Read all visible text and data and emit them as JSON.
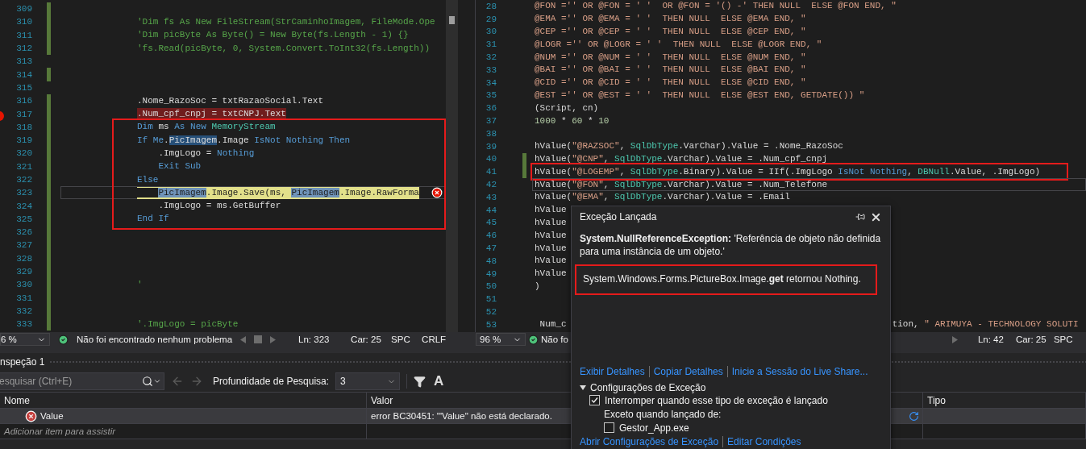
{
  "left_editor": {
    "blocks": [
      {
        "boxed": false,
        "lines": [
          {
            "number": "309",
            "changed": true,
            "breakpoint": false,
            "current": false,
            "caret": false
          },
          {
            "number": "310",
            "changed": true,
            "breakpoint": false,
            "current": false,
            "caret": false,
            "tokens": [
              {
                "text": "'Dim fs As New FileStream(StrCaminhoImagem, FileMode.Ope",
                "kind": "comment"
              }
            ]
          },
          {
            "number": "311",
            "changed": true,
            "breakpoint": false,
            "current": false,
            "caret": false,
            "tokens": [
              {
                "text": "'Dim picByte As Byte() = New Byte(fs.Length - 1) {}",
                "kind": "comment"
              }
            ]
          },
          {
            "number": "312",
            "changed": true,
            "breakpoint": false,
            "current": false,
            "caret": false,
            "tokens": [
              {
                "text": "'fs.Read(picByte, 0, System.Convert.ToInt32(fs.Length))",
                "kind": "comment"
              }
            ]
          },
          {
            "number": "313",
            "changed": false,
            "breakpoint": false,
            "current": false,
            "caret": false
          },
          {
            "number": "314",
            "changed": true,
            "breakpoint": false,
            "current": false,
            "caret": false
          },
          {
            "number": "315",
            "changed": false,
            "breakpoint": false,
            "current": false,
            "caret": false
          },
          {
            "number": "316",
            "changed": true,
            "breakpoint": false,
            "current": false,
            "caret": false,
            "tokens": [
              {
                "text": ".Nome_RazoSoc = txtRazaoSocial.Text",
                "kind": "plain"
              }
            ]
          },
          {
            "number": "317",
            "changed": true,
            "breakpoint": true,
            "current": false,
            "caret": false,
            "tokens": [
              {
                "text": ".Num_cpf_cnpj = txtCNPJ.Text",
                "kind": "plain"
              }
            ]
          }
        ]
      },
      {
        "boxed": true,
        "lines": [
          {
            "number": "318",
            "changed": true,
            "breakpoint": false,
            "current": false,
            "caret": false,
            "tokens": [
              {
                "text": "Dim",
                "kind": "kw"
              },
              {
                "text": " ms ",
                "kind": "plain"
              },
              {
                "text": "As New",
                "kind": "kw"
              },
              {
                "text": " MemoryStream",
                "kind": "type"
              }
            ]
          },
          {
            "number": "319",
            "changed": true,
            "breakpoint": false,
            "current": false,
            "caret": false,
            "tokens": [
              {
                "text": "If Me",
                "kind": "kw"
              },
              {
                "text": ".",
                "kind": "plain"
              },
              {
                "text": "PicImagem",
                "kind": "ref"
              },
              {
                "text": ".Image ",
                "kind": "plain"
              },
              {
                "text": "IsNot Nothing Then",
                "kind": "kw"
              }
            ]
          },
          {
            "number": "320",
            "changed": true,
            "breakpoint": false,
            "current": false,
            "caret": false,
            "tokens": [
              {
                "text": "    .ImgLogo = ",
                "kind": "plain"
              },
              {
                "text": "Nothing",
                "kind": "kw"
              }
            ]
          },
          {
            "number": "321",
            "changed": true,
            "breakpoint": false,
            "current": false,
            "caret": false,
            "tokens": [
              {
                "text": "    Exit Sub",
                "kind": "kw"
              }
            ]
          },
          {
            "number": "322",
            "changed": true,
            "breakpoint": false,
            "current": false,
            "caret": false,
            "tokens": [
              {
                "text": "Else",
                "kind": "kw"
              }
            ]
          },
          {
            "number": "323",
            "changed": true,
            "breakpoint": false,
            "current": true,
            "caret": true,
            "tokens": [
              {
                "text": "    PicImagem",
                "kind": "ref"
              },
              {
                "text": ".Image.Save(ms, ",
                "kind": "plain"
              },
              {
                "text": "PicImagem",
                "kind": "ref"
              },
              {
                "text": ".Image.RawForma",
                "kind": "plain"
              }
            ]
          },
          {
            "number": "324",
            "changed": true,
            "breakpoint": false,
            "current": false,
            "caret": false,
            "tokens": [
              {
                "text": "    .ImgLogo = ms.GetBuffer",
                "kind": "plain"
              }
            ]
          },
          {
            "number": "325",
            "changed": true,
            "breakpoint": false,
            "current": false,
            "caret": false,
            "tokens": [
              {
                "text": "End If",
                "kind": "kw"
              }
            ]
          }
        ]
      },
      {
        "boxed": false,
        "lines": [
          {
            "number": "326",
            "changed": true,
            "breakpoint": false,
            "current": false,
            "caret": false
          },
          {
            "number": "327",
            "changed": true,
            "breakpoint": false,
            "current": false,
            "caret": false
          },
          {
            "number": "328",
            "changed": true,
            "breakpoint": false,
            "current": false,
            "caret": false
          },
          {
            "number": "329",
            "changed": true,
            "breakpoint": false,
            "current": false,
            "caret": false
          },
          {
            "number": "330",
            "changed": true,
            "breakpoint": false,
            "current": false,
            "caret": false,
            "tokens": [
              {
                "text": "'",
                "kind": "comment"
              }
            ]
          },
          {
            "number": "331",
            "changed": true,
            "breakpoint": false,
            "current": false,
            "caret": false
          },
          {
            "number": "332",
            "changed": true,
            "breakpoint": false,
            "current": false,
            "caret": false
          },
          {
            "number": "333",
            "changed": true,
            "breakpoint": false,
            "current": false,
            "caret": false,
            "tokens": [
              {
                "text": "'.ImgLogo = picByte",
                "kind": "comment"
              }
            ]
          }
        ]
      }
    ],
    "status_bar": {
      "zoom": "6 %",
      "message": "Não foi encontrado nenhum problema",
      "line": "Ln: 323",
      "column": "Car: 25",
      "indent_mode": "SPC",
      "line_ending": "CRLF"
    }
  },
  "right_editor": {
    "blocks": [
      {
        "boxed": false,
        "lines": [
          {
            "number": "28",
            "changed": false,
            "caret": false,
            "tokens": [
              {
                "text": "@FON ='' OR @FON = ' '  OR @FON = '() -' THEN NULL  ELSE @FON END, \"",
                "kind": "str"
              }
            ]
          },
          {
            "number": "29",
            "changed": false,
            "caret": false,
            "tokens": [
              {
                "text": "@EMA ='' OR @EMA = ' '  THEN NULL  ELSE @EMA END, \"",
                "kind": "str"
              }
            ]
          },
          {
            "number": "30",
            "changed": false,
            "caret": false,
            "tokens": [
              {
                "text": "@CEP ='' OR @CEP = ' '  THEN NULL  ELSE @CEP END, \"",
                "kind": "str"
              }
            ]
          },
          {
            "number": "31",
            "changed": false,
            "caret": false,
            "tokens": [
              {
                "text": "@LOGR ='' OR @LOGR = ' '  THEN NULL  ELSE @LOGR END, \"",
                "kind": "str"
              }
            ]
          },
          {
            "number": "32",
            "changed": false,
            "caret": false,
            "tokens": [
              {
                "text": "@NUM ='' OR @NUM = ' '  THEN NULL  ELSE @NUM END, \"",
                "kind": "str"
              }
            ]
          },
          {
            "number": "33",
            "changed": false,
            "caret": false,
            "tokens": [
              {
                "text": "@BAI ='' OR @BAI = ' '  THEN NULL  ELSE @BAI END, \"",
                "kind": "str"
              }
            ]
          },
          {
            "number": "34",
            "changed": false,
            "caret": false,
            "tokens": [
              {
                "text": "@CID ='' OR @CID = ' '  THEN NULL  ELSE @CID END, \"",
                "kind": "str"
              }
            ]
          },
          {
            "number": "35",
            "changed": false,
            "caret": false,
            "tokens": [
              {
                "text": "@EST ='' OR @EST = ' '  THEN NULL  ELSE @EST END, GETDATE()) \"",
                "kind": "str"
              }
            ]
          },
          {
            "number": "36",
            "changed": false,
            "caret": false,
            "tokens": [
              {
                "text": "(Script, cn)",
                "kind": "plain"
              }
            ]
          },
          {
            "number": "37",
            "changed": false,
            "caret": false,
            "tokens": [
              {
                "text": "1000",
                "kind": "num"
              },
              {
                "text": " * ",
                "kind": "plain"
              },
              {
                "text": "60",
                "kind": "num"
              },
              {
                "text": " * ",
                "kind": "plain"
              },
              {
                "text": "10",
                "kind": "num"
              }
            ]
          },
          {
            "number": "38",
            "changed": false,
            "caret": false
          },
          {
            "number": "39",
            "changed": false,
            "caret": false,
            "tokens": [
              {
                "text": "hValue(",
                "kind": "plain"
              },
              {
                "text": "\"@RAZSOC\"",
                "kind": "str"
              },
              {
                "text": ", ",
                "kind": "plain"
              },
              {
                "text": "SqlDbType",
                "kind": "type"
              },
              {
                "text": ".VarChar).Value = .Nome_RazoSoc",
                "kind": "plain"
              }
            ]
          },
          {
            "number": "40",
            "changed": true,
            "caret": false,
            "tokens": [
              {
                "text": "hValue(",
                "kind": "plain"
              },
              {
                "text": "\"@CNP\"",
                "kind": "str"
              },
              {
                "text": ", ",
                "kind": "plain"
              },
              {
                "text": "SqlDbType",
                "kind": "type"
              },
              {
                "text": ".VarChar).Value = .Num_cpf_cnpj",
                "kind": "plain"
              }
            ]
          }
        ]
      },
      {
        "boxed": true,
        "lines": [
          {
            "number": "41",
            "changed": true,
            "caret": false,
            "tokens": [
              {
                "text": "hValue(",
                "kind": "plain"
              },
              {
                "text": "\"@LOGEMP\"",
                "kind": "str"
              },
              {
                "text": ", ",
                "kind": "plain"
              },
              {
                "text": "SqlDbType",
                "kind": "type"
              },
              {
                "text": ".Binary).Value = IIf(.ImgLogo ",
                "kind": "plain"
              },
              {
                "text": "IsNot Nothing",
                "kind": "kw"
              },
              {
                "text": ", ",
                "kind": "plain"
              },
              {
                "text": "DBNull",
                "kind": "type"
              },
              {
                "text": ".Value, .ImgLogo)",
                "kind": "plain"
              }
            ]
          }
        ]
      },
      {
        "boxed": false,
        "lines": [
          {
            "number": "42",
            "changed": false,
            "caret": true,
            "tokens": [
              {
                "text": "hValue(",
                "kind": "plain"
              },
              {
                "text": "\"@FON\"",
                "kind": "str"
              },
              {
                "text": ", ",
                "kind": "plain"
              },
              {
                "text": "SqlDbType",
                "kind": "type"
              },
              {
                "text": ".VarChar).Value = .Num_Telefone",
                "kind": "plain"
              }
            ]
          },
          {
            "number": "43",
            "changed": false,
            "caret": false,
            "tokens": [
              {
                "text": "hValue(",
                "kind": "plain"
              },
              {
                "text": "\"@EMA\"",
                "kind": "str"
              },
              {
                "text": ", ",
                "kind": "plain"
              },
              {
                "text": "SqlDbType",
                "kind": "type"
              },
              {
                "text": ".VarChar).Value = .Email",
                "kind": "plain"
              }
            ]
          },
          {
            "number": "44",
            "changed": false,
            "caret": false,
            "tokens": [
              {
                "text": "hValue",
                "kind": "plain"
              }
            ]
          },
          {
            "number": "45",
            "changed": false,
            "caret": false,
            "tokens": [
              {
                "text": "hValue",
                "kind": "plain"
              }
            ]
          },
          {
            "number": "46",
            "changed": false,
            "caret": false,
            "tokens": [
              {
                "text": "hValue",
                "kind": "plain"
              }
            ]
          },
          {
            "number": "47",
            "changed": false,
            "caret": false,
            "tokens": [
              {
                "text": "hValue",
                "kind": "plain"
              }
            ]
          },
          {
            "number": "48",
            "changed": false,
            "caret": false,
            "tokens": [
              {
                "text": "hValue",
                "kind": "plain"
              }
            ]
          },
          {
            "number": "49",
            "changed": false,
            "caret": false,
            "tokens": [
              {
                "text": "hValue",
                "kind": "plain"
              }
            ]
          },
          {
            "number": "50",
            "changed": false,
            "caret": false,
            "tokens": [
              {
                "text": ")",
                "kind": "plain"
              }
            ]
          },
          {
            "number": "51",
            "changed": false,
            "caret": false
          },
          {
            "number": "52",
            "changed": false,
            "caret": false
          },
          {
            "number": "53",
            "changed": false,
            "caret": false,
            "tokens": [
              {
                "text": " Num_c",
                "kind": "plain"
              },
              {
                "text": "tion, ",
                "kind": "plain",
                "gap_before": true
              },
              {
                "text": "\" ARIMUYA - TECHNOLOGY SOLUTI",
                "kind": "str"
              }
            ]
          }
        ]
      }
    ],
    "status_bar": {
      "zoom": "96 %",
      "message": "Não fo",
      "line": "Ln: 42",
      "column": "Car: 25",
      "indent_mode": "SPC"
    }
  },
  "watch": {
    "title": "nspeção 1",
    "search": {
      "placeholder": "esquisar (Ctrl+E)"
    },
    "depth_label": "Profundidade de Pesquisa:",
    "depth": "3",
    "font_button": "A",
    "columns": [
      "Nome",
      "Valor",
      "Tipo"
    ],
    "rows": [
      {
        "kind": "error",
        "name": "Value",
        "value": "error BC30451: '\"Value\" não está declarado.",
        "selected": true
      },
      {
        "kind": "add",
        "name": "Adicionar item para assistir",
        "selected": false
      }
    ]
  },
  "popup": {
    "title": "Exceção Lançada",
    "message": "**System.NullReferenceException:** 'Referência de objeto não definida para uma instância de um objeto.'",
    "detail": "System.Windows.Forms.PictureBox.Image.**get** retornou Nothing.",
    "links": [
      "Exibir Detalhes",
      "Copiar Detalhes",
      "Inicie a Sessão do Live Share..."
    ],
    "settings": {
      "title": "Configurações de Exceção",
      "expanded": true,
      "options": [
        {
          "kind": "checkbox",
          "label": "Interromper quando esse tipo de exceção é lançado",
          "checked": true
        },
        {
          "kind": "note",
          "label": "Exceto quando lançado de:"
        },
        {
          "kind": "source_checkbox",
          "label": "Gestor_App.exe",
          "checked": false
        }
      ]
    },
    "footer_links": [
      "Abrir Configurações de Exceção",
      "Editar Condições"
    ]
  }
}
